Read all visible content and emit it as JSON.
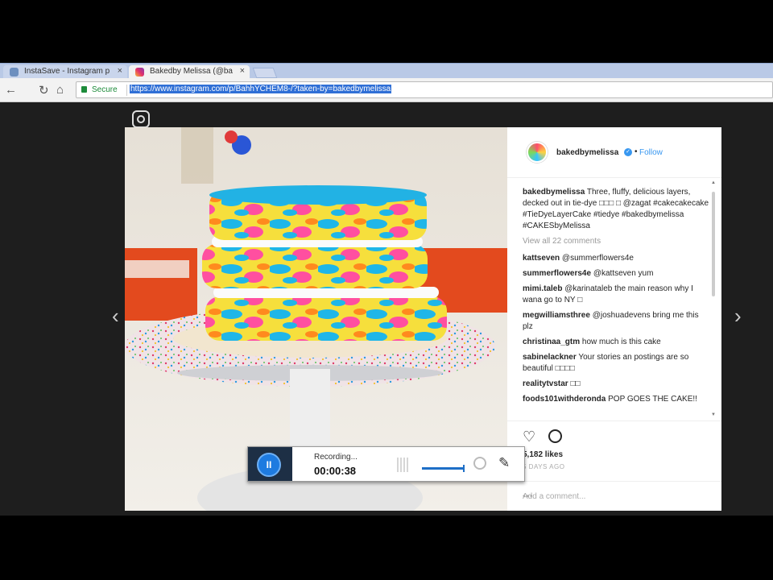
{
  "browser": {
    "tabs": [
      {
        "label": "InstaSave - Instagram p",
        "close": "×"
      },
      {
        "label": "Bakedby Melissa (@ba",
        "close": "×"
      }
    ],
    "nav": {
      "back": "←",
      "reload": "↻",
      "home": "⌂"
    },
    "secure_label": "Secure",
    "url": "https://www.instagram.com/p/BahhYCHEM8-/?taken-by=bakedbymelissa"
  },
  "viewer": {
    "prev": "‹",
    "next": "›"
  },
  "post": {
    "username": "bakedbymelissa",
    "verified_glyph": "✓",
    "dot": "•",
    "follow_label": "Follow",
    "comments": [
      {
        "user": "bakedbymelissa",
        "text": "Three, fluffy, delicious layers, decked out in tie-dye □□□ □ @zagat #cakecakecake #TieDyeLayerCake #tiedye #bakedbymelissa #CAKESbyMelissa"
      },
      {
        "user": "kattseven",
        "text": "@summerflowers4e"
      },
      {
        "user": "summerflowers4e",
        "text": "@kattseven yum"
      },
      {
        "user": "mimi.taleb",
        "text": "@karinataleb the main reason why I wana go to NY □"
      },
      {
        "user": "megwilliamsthree",
        "text": "@joshuadevens bring me this plz"
      },
      {
        "user": "christinaa_gtm",
        "text": "how much is this cake"
      },
      {
        "user": "sabinelackner",
        "text": "Your stories an postings are so beautiful □□□□"
      },
      {
        "user": "realitytvstar",
        "text": "□□"
      },
      {
        "user": "foods101withderonda",
        "text": "POP GOES THE CAKE!!"
      }
    ],
    "view_all": "View all 22 comments",
    "likes": "5,182 likes",
    "time_ago": "5 DAYS AGO",
    "add_comment_placeholder": "Add a comment...",
    "more": "•••"
  },
  "recorder": {
    "pause_glyph": "II",
    "status": "Recording...",
    "time": "00:00:38",
    "pen_glyph": "✎"
  },
  "colors": {
    "accent": "#3897f0",
    "recorder_blue": "#1e7be0",
    "tabbar": "#b9c9e6"
  }
}
